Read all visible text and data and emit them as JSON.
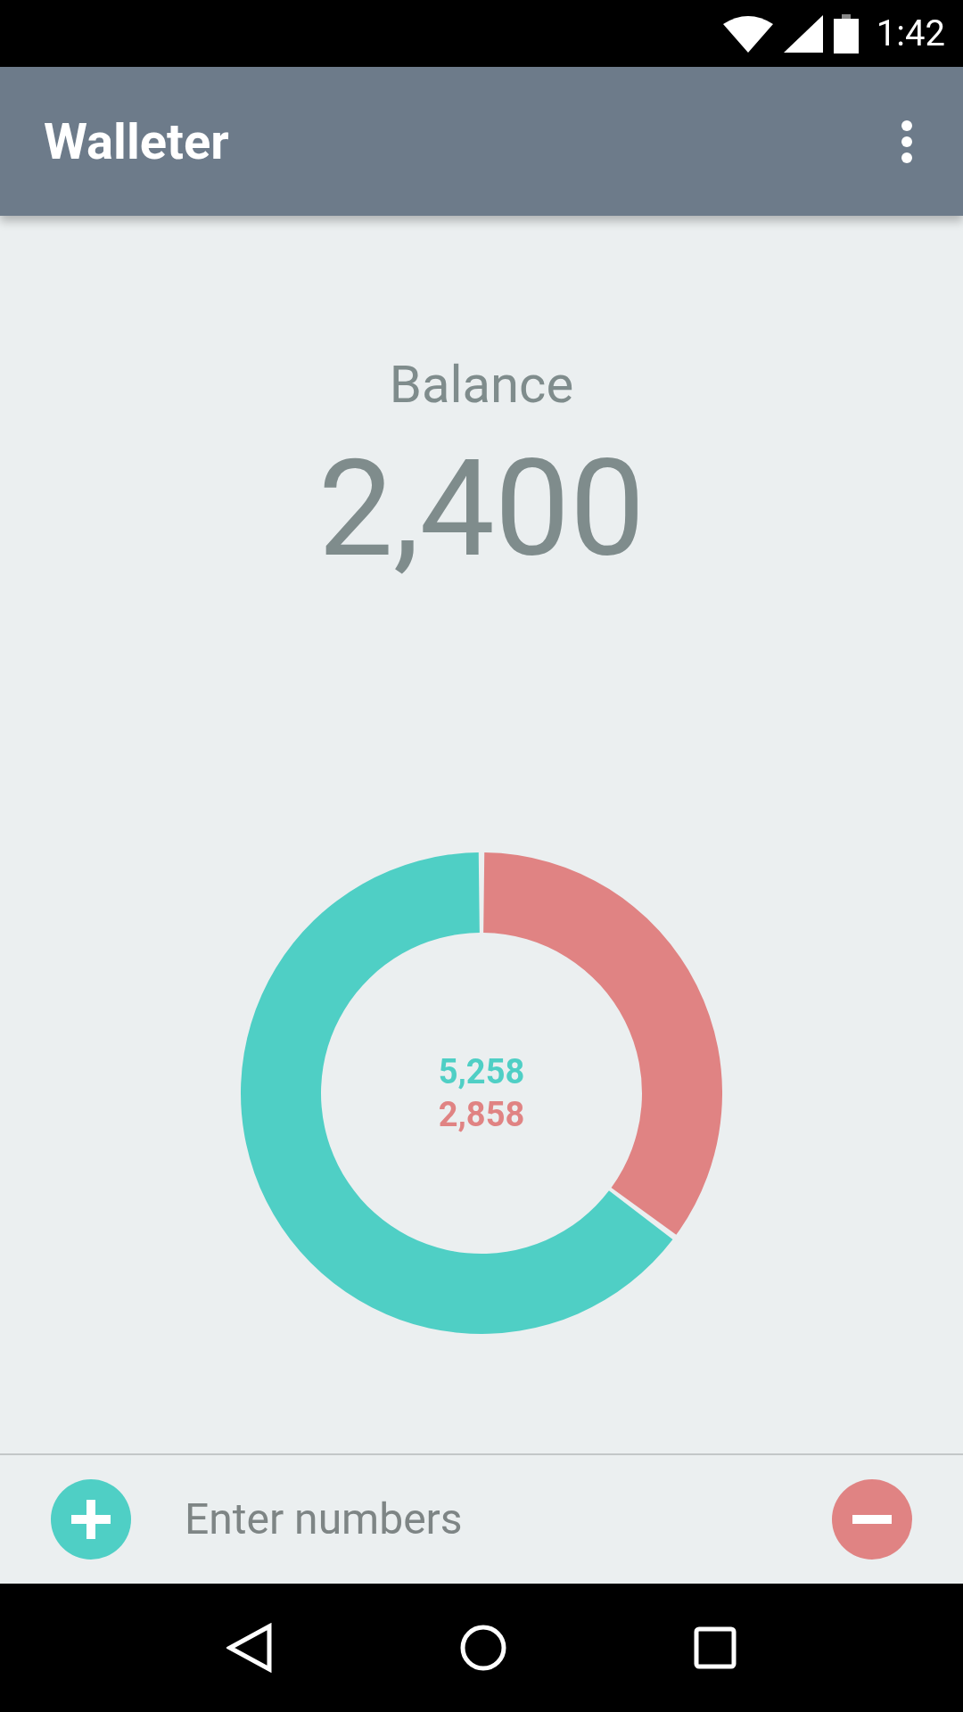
{
  "status_bar": {
    "time": "1:42"
  },
  "app_bar": {
    "title": "Walleter"
  },
  "balance": {
    "label": "Balance",
    "value": "2,400"
  },
  "chart": {
    "chart_data": {
      "type": "donut",
      "values": [
        64.8,
        35.2
      ]
    },
    "labels": [
      {
        "text": "5,258",
        "color": "#4fcfc5"
      },
      {
        "text": "2,858",
        "color": "#e08383"
      }
    ]
  },
  "entry": {
    "placeholder": "Enter numbers"
  }
}
